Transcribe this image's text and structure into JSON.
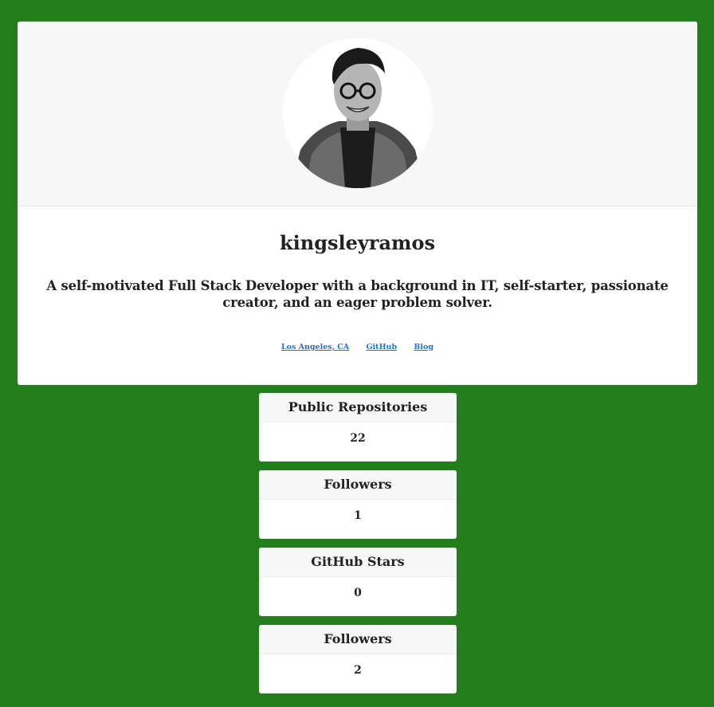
{
  "profile": {
    "username": "kingsleyramos",
    "bio": "A self-motivated Full Stack Developer with a background in IT, self-starter, passionate creator, and an eager problem solver.",
    "links": [
      {
        "label": "Los Angeles, CA"
      },
      {
        "label": "GitHub"
      },
      {
        "label": "Blog"
      }
    ]
  },
  "stats": [
    {
      "label": "Public Repositories",
      "value": "22"
    },
    {
      "label": "Followers",
      "value": "1"
    },
    {
      "label": "GitHub Stars",
      "value": "0"
    },
    {
      "label": "Followers",
      "value": "2"
    }
  ],
  "colors": {
    "page_background": "#217e1a",
    "card_background": "#ffffff",
    "header_background": "#f7f7f7",
    "link": "#1a73e8"
  }
}
